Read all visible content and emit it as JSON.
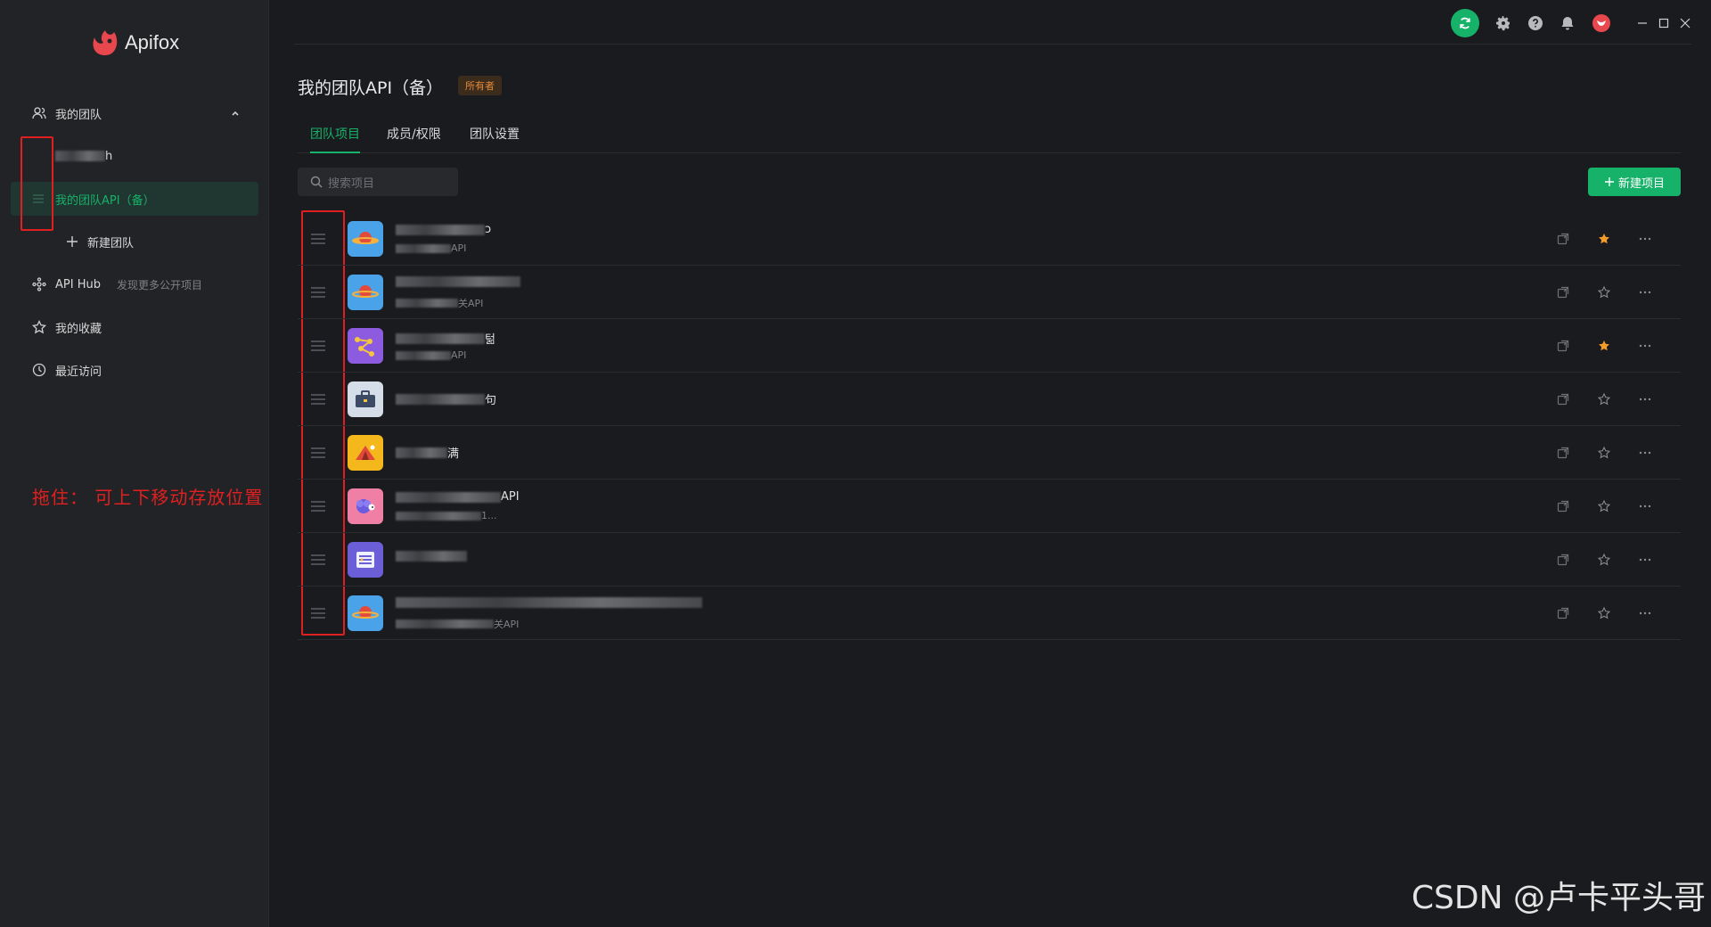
{
  "app": {
    "name": "Apifox",
    "brand_color": "#e8474e",
    "accent_color": "#17b26a"
  },
  "sidebar": {
    "my_team_label": "我的团队",
    "teams": [
      {
        "label": "h",
        "active": false
      },
      {
        "label": "我的团队API（备）",
        "active": true
      }
    ],
    "new_team_label": "新建团队",
    "api_hub_label": "API Hub",
    "api_hub_sub": "发现更多公开项目",
    "favorites_label": "我的收藏",
    "recent_label": "最近访问"
  },
  "annotation": {
    "text": "拖住：  可上下移动存放位置",
    "color": "#e02020"
  },
  "header": {
    "title": "我的团队API（备）",
    "owner_badge": "所有者"
  },
  "tabs": [
    {
      "label": "团队项目",
      "active": true
    },
    {
      "label": "成员/权限",
      "active": false
    },
    {
      "label": "团队设置",
      "active": false
    }
  ],
  "search": {
    "placeholder": "搜索项目"
  },
  "new_project_label": "新建项目",
  "projects": [
    {
      "name": "ɔ",
      "desc": "API",
      "icon": "planet-icon",
      "starred": true
    },
    {
      "name": "",
      "desc": "关API",
      "icon": "planet-icon",
      "starred": false
    },
    {
      "name": "턺",
      "desc": "API",
      "icon": "constellation-icon",
      "starred": true
    },
    {
      "name": "句",
      "desc": "",
      "icon": "briefcase-icon",
      "starred": false
    },
    {
      "name": "满",
      "desc": "",
      "icon": "tent-icon",
      "starred": false
    },
    {
      "name": "API",
      "desc": "1...",
      "icon": "sheep-icon",
      "starred": false
    },
    {
      "name": "",
      "desc": "",
      "icon": "list-icon",
      "starred": false
    },
    {
      "name": "",
      "desc": "关API",
      "icon": "planet-icon",
      "starred": false
    }
  ],
  "watermark": "CSDN @卢卡平头哥"
}
